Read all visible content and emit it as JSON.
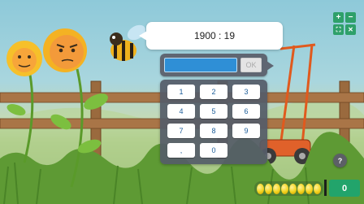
{
  "question": {
    "operation": "1900 : 19"
  },
  "answer": {
    "value": "",
    "ok_label": "OK"
  },
  "keypad": {
    "keys": [
      "1",
      "2",
      "3",
      "4",
      "5",
      "6",
      "7",
      "8",
      "9",
      ",",
      "0"
    ]
  },
  "controls": {
    "zoom_in": "+",
    "zoom_out": "−",
    "fullscreen": "⛶",
    "close": "✕"
  },
  "help": {
    "label": "?"
  },
  "progress": {
    "coins_shown": 8
  },
  "score": {
    "value": "0"
  },
  "colors": {
    "accent_green": "#22a46b",
    "answer_blue": "#2f8fd6",
    "coin_gold": "#f3d21c"
  }
}
